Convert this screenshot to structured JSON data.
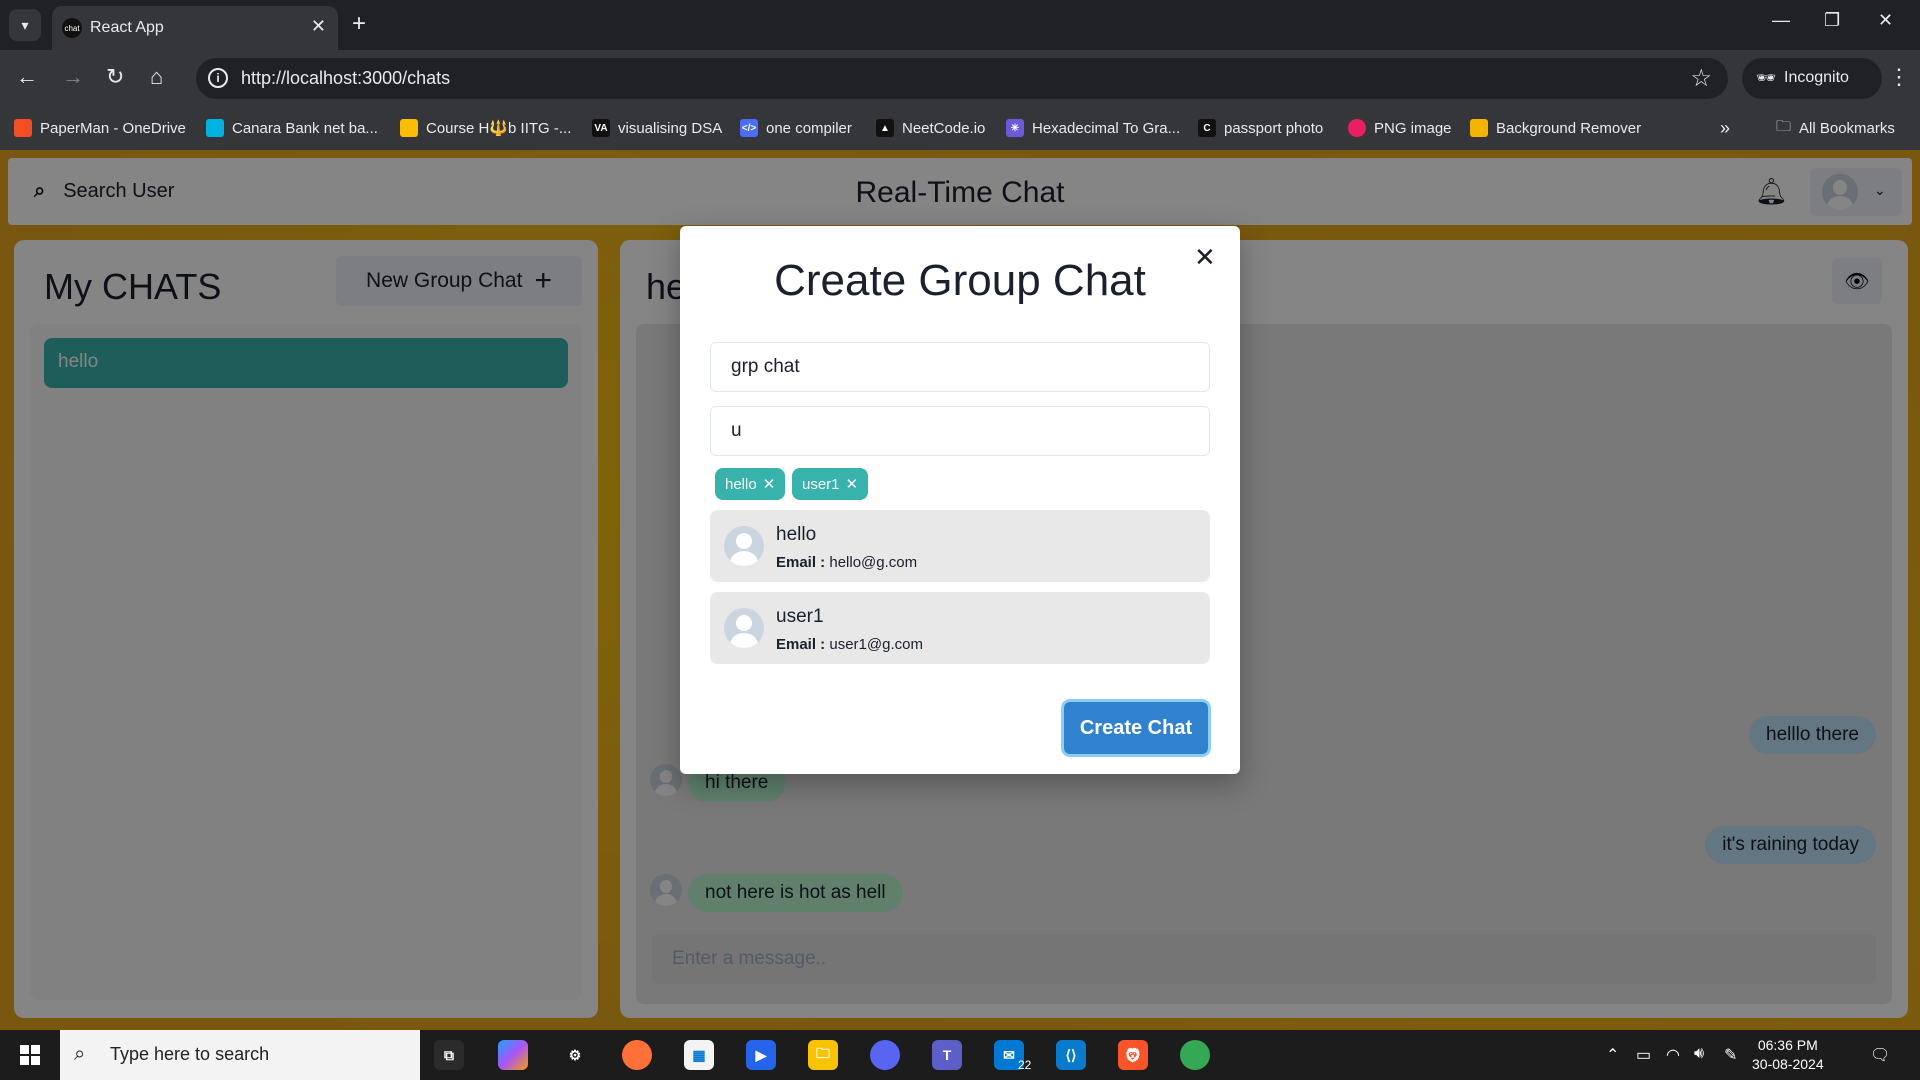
{
  "browser": {
    "tab_title": "React App",
    "tab_favicon_text": "chat",
    "url": "http://localhost:3000/chats",
    "incognito_label": "Incognito",
    "bookmarks": [
      {
        "label": "PaperMan - OneDrive",
        "color": "#f25022"
      },
      {
        "label": "Canara Bank net ba...",
        "color": "#00b3e3"
      },
      {
        "label": "Course H🔱b IITG -...",
        "color": "#fbbc04"
      },
      {
        "label": "visualising DSA",
        "color": "#111111"
      },
      {
        "label": "one compiler",
        "color": "#4a6cf7"
      },
      {
        "label": "NeetCode.io",
        "color": "#111111"
      },
      {
        "label": "Hexadecimal To Gra...",
        "color": "#6b5bd6"
      },
      {
        "label": "passport photo",
        "color": "#111111"
      },
      {
        "label": "PNG image",
        "color": "#e91e63"
      },
      {
        "label": "Background Remover",
        "color": "#f5b400"
      }
    ],
    "all_bookmarks_label": "All Bookmarks"
  },
  "header": {
    "search_label": "Search User",
    "app_title": "Real-Time Chat"
  },
  "my_chats": {
    "title": "My CHATS",
    "new_group_label": "New Group Chat",
    "chats": [
      {
        "name": "hello"
      }
    ]
  },
  "chat_box": {
    "title_visible": "he",
    "messages": [
      {
        "text": "helllo there",
        "sender": "me"
      },
      {
        "text": "hi there",
        "sender": "other"
      },
      {
        "text": "it's raining today",
        "sender": "me"
      },
      {
        "text": "not here is hot as hell",
        "sender": "other"
      }
    ],
    "input_placeholder": "Enter a message.."
  },
  "modal": {
    "title": "Create Group Chat",
    "chat_name_value": "grp chat",
    "search_value": "u",
    "selected_users": [
      "hello",
      "user1"
    ],
    "results": [
      {
        "name": "hello",
        "email_label": "Email :",
        "email": "hello@g.com"
      },
      {
        "name": "user1",
        "email_label": "Email :",
        "email": "user1@g.com"
      }
    ],
    "create_label": "Create Chat"
  },
  "taskbar": {
    "search_placeholder": "Type here to search",
    "mail_badge": "22",
    "time": "06:36 PM",
    "date": "30-08-2024"
  },
  "colors": {
    "accent_teal": "#38b2ac",
    "primary_blue": "#3182ce",
    "mine_bubble": "#bee3f8",
    "their_bubble": "#b9f5d0"
  }
}
